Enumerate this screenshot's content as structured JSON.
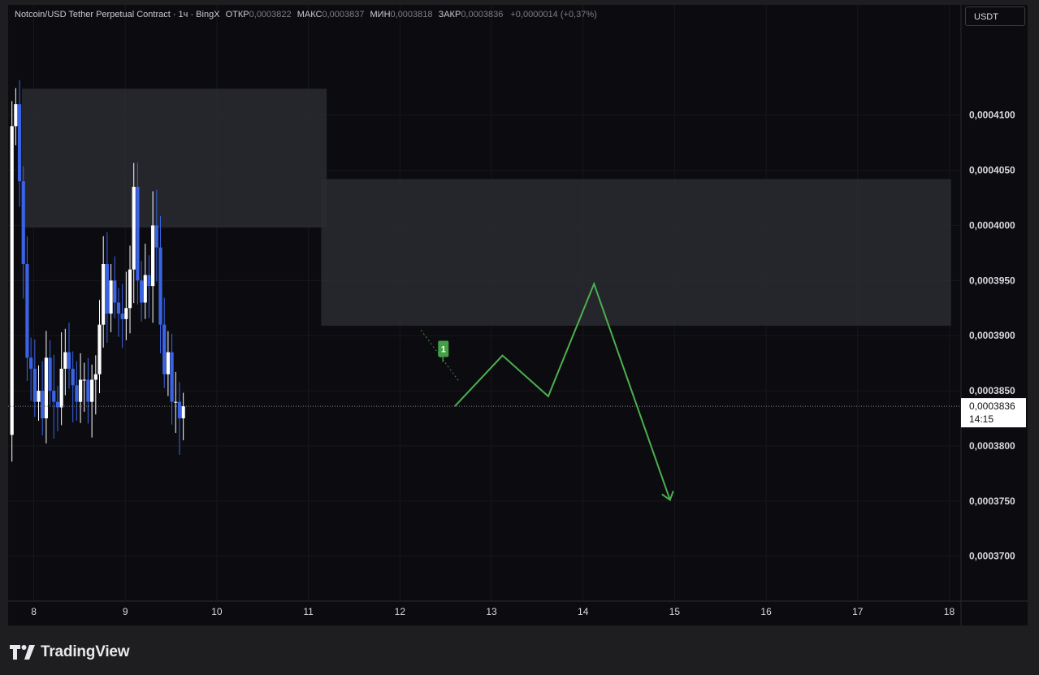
{
  "header": {
    "symbol": "Notcoin/USD Tether Perpetual Contract · 1ч · BingX",
    "open_label": "ОТКР",
    "open_value": "0,0003822",
    "high_label": "МАКС",
    "high_value": "0,0003837",
    "low_label": "МИН",
    "low_value": "0,0003818",
    "close_label": "ЗАКР",
    "close_value": "0,0003836",
    "change": "+0,0000014 (+0,37%)"
  },
  "currency_button": "USDT",
  "footer": {
    "brand": "TradingView"
  },
  "colors": {
    "background": "#0c0c10",
    "bull": "#ffffff",
    "bear": "#3a63e6",
    "zone": "#2a2b30",
    "projection": "#4caf50",
    "badge": "#43a047"
  },
  "chart_data": {
    "type": "candlestick",
    "x_ticks": [
      "8",
      "9",
      "10",
      "11",
      "12",
      "13",
      "14",
      "15",
      "16",
      "17",
      "18"
    ],
    "y_ticks": [
      "0,0003700",
      "0,0003750",
      "0,0003800",
      "0,0003850",
      "0,0003900",
      "0,0003950",
      "0,0004000",
      "0,0004050",
      "0,0004100"
    ],
    "ylim": [
      0.000366,
      0.00042
    ],
    "xlim": [
      7.72,
      18.12
    ],
    "last_price": {
      "label": "0,0003836",
      "countdown": "14:15",
      "value": 0.0003836
    },
    "zones": [
      {
        "x_from": 7.87,
        "x_to": 11.2,
        "y_from": 0.0003998,
        "y_to": 0.0004124
      },
      {
        "x_from": 11.14,
        "x_to": 18.02,
        "y_from": 0.0003909,
        "y_to": 0.0004042
      }
    ],
    "projection": [
      [
        12.6,
        0.0003836
      ],
      [
        13.12,
        0.0003882
      ],
      [
        13.62,
        0.0003845
      ],
      [
        14.12,
        0.0003947
      ],
      [
        14.95,
        0.0003751
      ]
    ],
    "marker": {
      "label": "1",
      "x": 12.47,
      "y": 0.0003888
    },
    "candles_spec": {
      "start": 7.72,
      "step": 0.0416,
      "keys": [
        0.000381,
        0.000409,
        0.000411,
        0.000404,
        0.0003965,
        0.000388,
        0.000387,
        0.000384,
        0.000385,
        0.0003825,
        0.000388,
        0.000385,
        0.000384,
        0.0003835,
        0.000387,
        0.0003885,
        0.000387,
        0.0003855,
        0.000384,
        0.000386,
        0.000386,
        0.000384,
        0.000386,
        0.0003865,
        0.000391,
        0.0003965,
        0.000392,
        0.000395,
        0.000393,
        0.000392,
        0.0003915,
        0.0003925,
        0.000396,
        0.0004035,
        0.000395,
        0.000393,
        0.0003955,
        0.0003945,
        0.0004,
        0.000398,
        0.000391,
        0.0003865,
        0.0003885,
        0.000384,
        0.000384,
        0.0003825,
        0.0003836
      ]
    }
  }
}
